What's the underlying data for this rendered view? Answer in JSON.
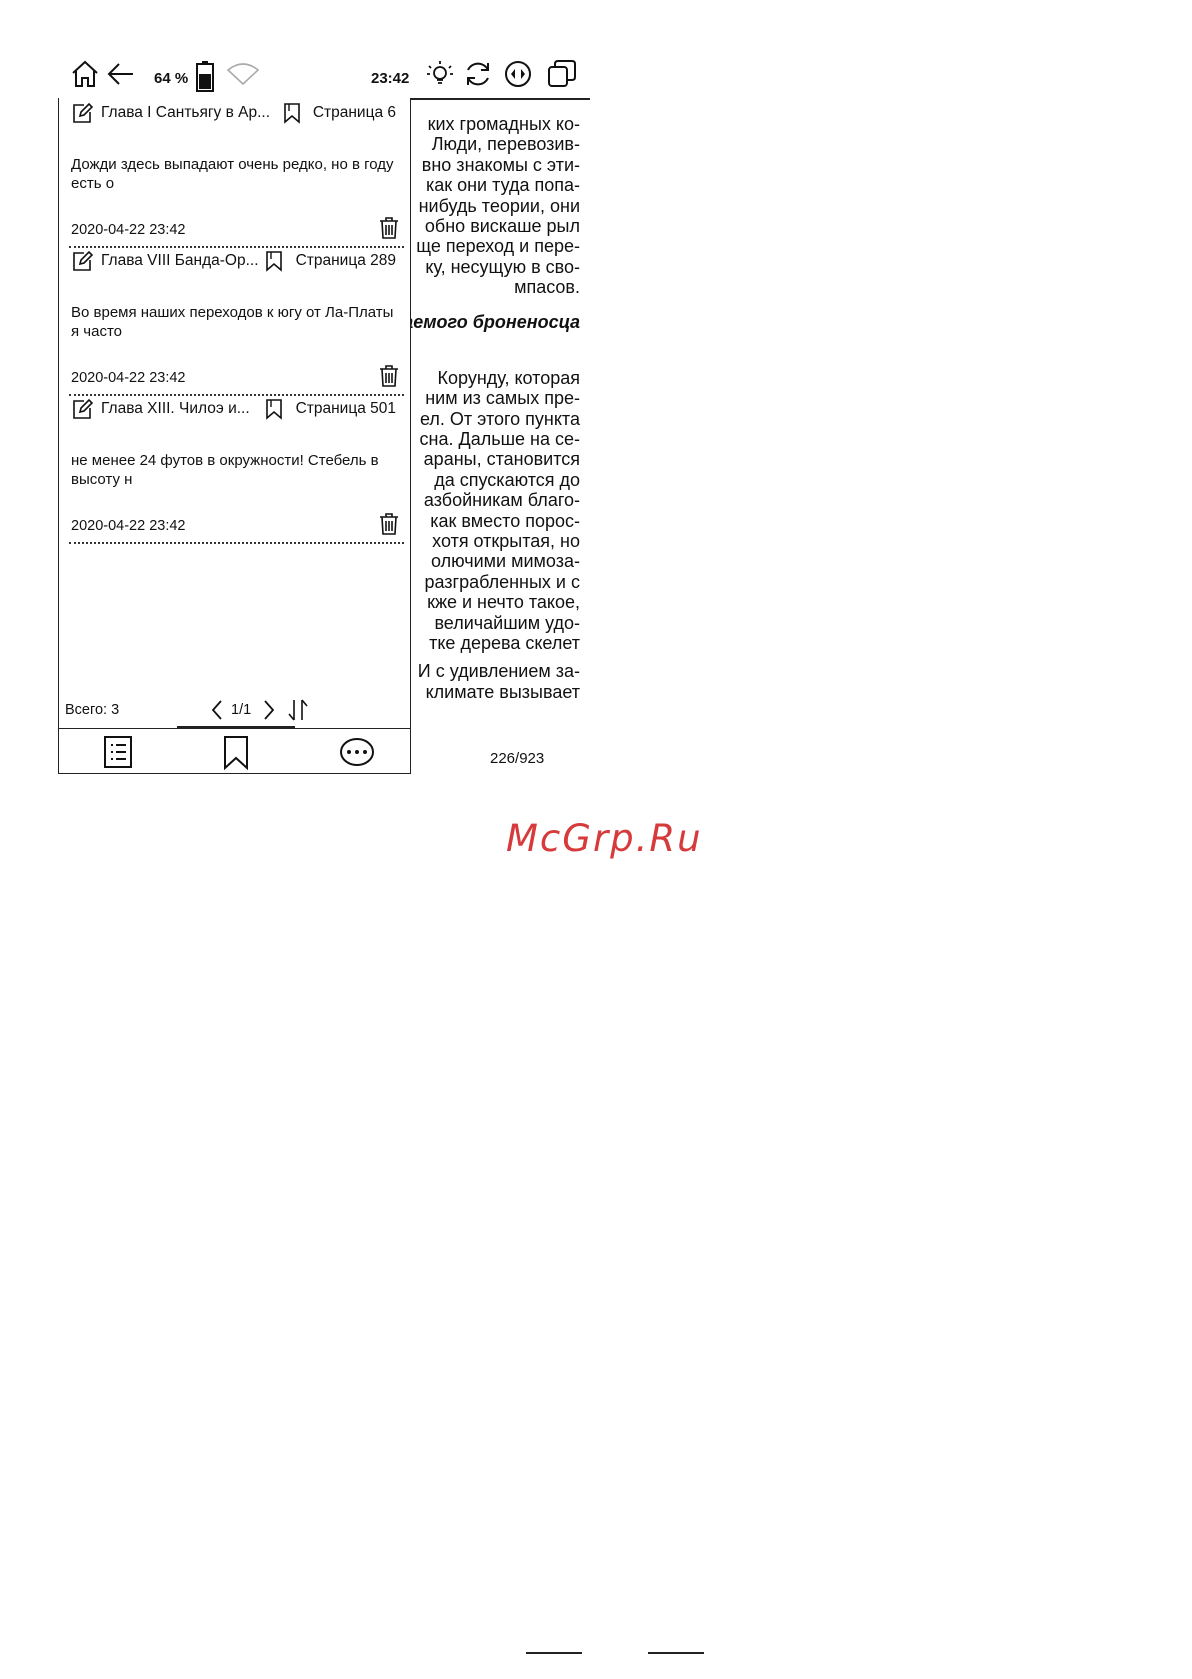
{
  "status_bar": {
    "battery_percent": "64 %",
    "time": "23:42",
    "battery_level": 0.6
  },
  "reader": {
    "lines": [
      "ких громадных ко-",
      "Люди, перевозив-",
      "вно знакомы с эти-",
      "как они туда попа-",
      "нибудь теории, они",
      "обно вискаше рыл",
      "ще переход и пере-",
      "ку, несущую в сво-",
      "мпасов."
    ],
    "heading": "аемого броненосца",
    "lines2": [
      "Корунду, которая",
      "ним из самых пре-",
      "ел. От этого пункта",
      "сна. Дальше на се-",
      "араны, становится",
      "да спускаются до",
      "азбойникам благо-",
      "как вместо порос-",
      "хотя открытая, но",
      "олючими мимоза-",
      "разграбленных и с",
      "кже и нечто такое,",
      "величайшим удо-",
      "тке дерева скелет"
    ],
    "lines3": [
      "И с удивлением за-",
      "климате вызывает"
    ],
    "page_number": "226/923"
  },
  "notes_panel": {
    "notes": [
      {
        "chapter": "Глава I Сантьягу в Ар...",
        "page": "Страница 6",
        "text": "Дожди здесь выпадают очень редко, но в году есть о",
        "date": "2020-04-22 23:42"
      },
      {
        "chapter": "Глава VIII Банда-Ор...",
        "page": "Страница 289",
        "text": "Во время наших переходов к югу от Ла-Платы я часто",
        "date": "2020-04-22 23:42"
      },
      {
        "chapter": "Глава XIII. Чилоэ и...",
        "page": "Страница 501",
        "text": "не менее 24 футов в окружности! Стебель в высоту н",
        "date": "2020-04-22 23:42"
      }
    ],
    "total": "Всего: 3",
    "pagination": "1/1"
  },
  "watermark": "McGrp.Ru"
}
